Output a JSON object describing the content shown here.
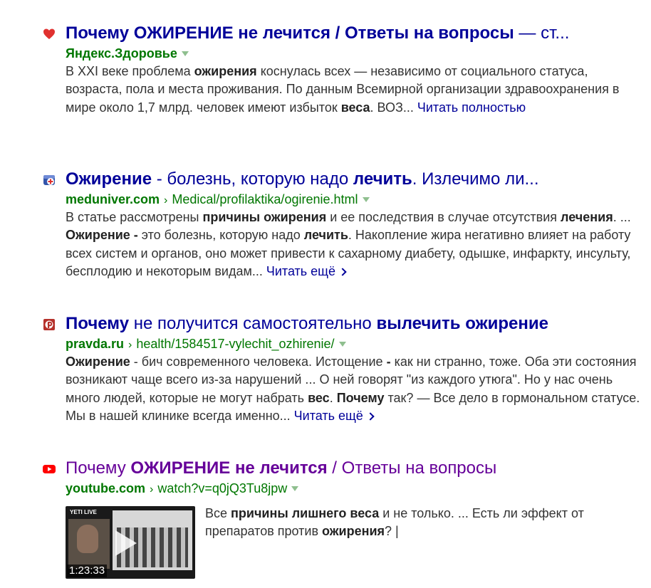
{
  "results": [
    {
      "favicon": "heart-icon",
      "title": [
        {
          "t": "Почему ",
          "b": true
        },
        {
          "t": "ОЖИРЕНИЕ",
          "b": true
        },
        {
          "t": " не лечится / Ответы на вопросы",
          "b": true
        },
        {
          "t": " — ст...",
          "b": false
        }
      ],
      "site": "Яндекс.Здоровье",
      "path": "",
      "snippet": [
        {
          "t": "В XXI веке проблема ",
          "b": false
        },
        {
          "t": "ожирения",
          "b": true
        },
        {
          "t": " коснулась всех — независимо от социального статуса, возраста, пола и места проживания. По данным Всемирной организации здравоохранения в мире около 1,7 млрд. человек имеют избыток ",
          "b": false
        },
        {
          "t": "веса",
          "b": true
        },
        {
          "t": ". ВОЗ... ",
          "b": false
        }
      ],
      "more": "Читать полностью"
    },
    {
      "favicon": "medical-cross-icon",
      "title": [
        {
          "t": "Ожирение",
          "b": true
        },
        {
          "t": " - болезнь, которую надо ",
          "b": false
        },
        {
          "t": "лечить",
          "b": true
        },
        {
          "t": ". Излечимо ли...",
          "b": false
        }
      ],
      "site": "meduniver.com",
      "path": "Medical/profilaktika/ogirenie.html",
      "snippet": [
        {
          "t": "В статье рассмотрены ",
          "b": false
        },
        {
          "t": "причины ожирения",
          "b": true
        },
        {
          "t": " и ее последствия в случае отсутствия ",
          "b": false
        },
        {
          "t": "лечения",
          "b": true
        },
        {
          "t": ". ... ",
          "b": false
        },
        {
          "t": "Ожирение -",
          "b": true
        },
        {
          "t": " это болезнь, которую надо ",
          "b": false
        },
        {
          "t": "лечить",
          "b": true
        },
        {
          "t": ". Накопление жира негативно влияет на работу всех систем и органов, оно может привести к сахарному диабету, одышке, инфаркту, инсульту, бесплодию и некоторым видам... ",
          "b": false
        }
      ],
      "more": "Читать ещё"
    },
    {
      "favicon": "pravda-logo-icon",
      "title": [
        {
          "t": "Почему",
          "b": true
        },
        {
          "t": " не получится самостоятельно ",
          "b": false
        },
        {
          "t": "вылечить ожирение",
          "b": true
        }
      ],
      "site": "pravda.ru",
      "path": "health/1584517-vylechit_ozhirenie/",
      "snippet": [
        {
          "t": "Ожирение",
          "b": true
        },
        {
          "t": " - бич современного человека. Истощение ",
          "b": false
        },
        {
          "t": "-",
          "b": true
        },
        {
          "t": " как ни странно, тоже. Оба эти состояния возникают чаще всего из-за нарушений ... О ней говорят \"из каждого утюга\". Но у нас очень много людей, которые не могут набрать ",
          "b": false
        },
        {
          "t": "вес",
          "b": true
        },
        {
          "t": ". ",
          "b": false
        },
        {
          "t": "Почему",
          "b": true
        },
        {
          "t": " так? — Все дело в гормональном статусе. Мы в нашей клинике всегда именно... ",
          "b": false
        }
      ],
      "more": "Читать ещё"
    },
    {
      "favicon": "youtube-icon",
      "title": [
        {
          "t": "Почему ",
          "b": false
        },
        {
          "t": "ОЖИРЕНИЕ",
          "b": true
        },
        {
          "t": " ",
          "b": false
        },
        {
          "t": "не лечится",
          "b": true
        },
        {
          "t": " / Ответы на вопросы",
          "b": false
        }
      ],
      "site": "youtube.com",
      "path": "watch?v=q0jQ3Tu8jpw",
      "video": {
        "duration": "1:23:33",
        "channel_badge": "YETI LIVE"
      },
      "snippet": [
        {
          "t": "Все ",
          "b": false
        },
        {
          "t": "причины лишнего веса",
          "b": true
        },
        {
          "t": " и не только. ... Есть ли эффект от препаратов против ",
          "b": false
        },
        {
          "t": "ожирения",
          "b": true
        },
        {
          "t": "? |",
          "b": false
        }
      ],
      "more": ""
    }
  ],
  "colors": {
    "link": "#000099",
    "visited": "#660099",
    "url_green": "#007700",
    "snippet_text": "#333333"
  }
}
